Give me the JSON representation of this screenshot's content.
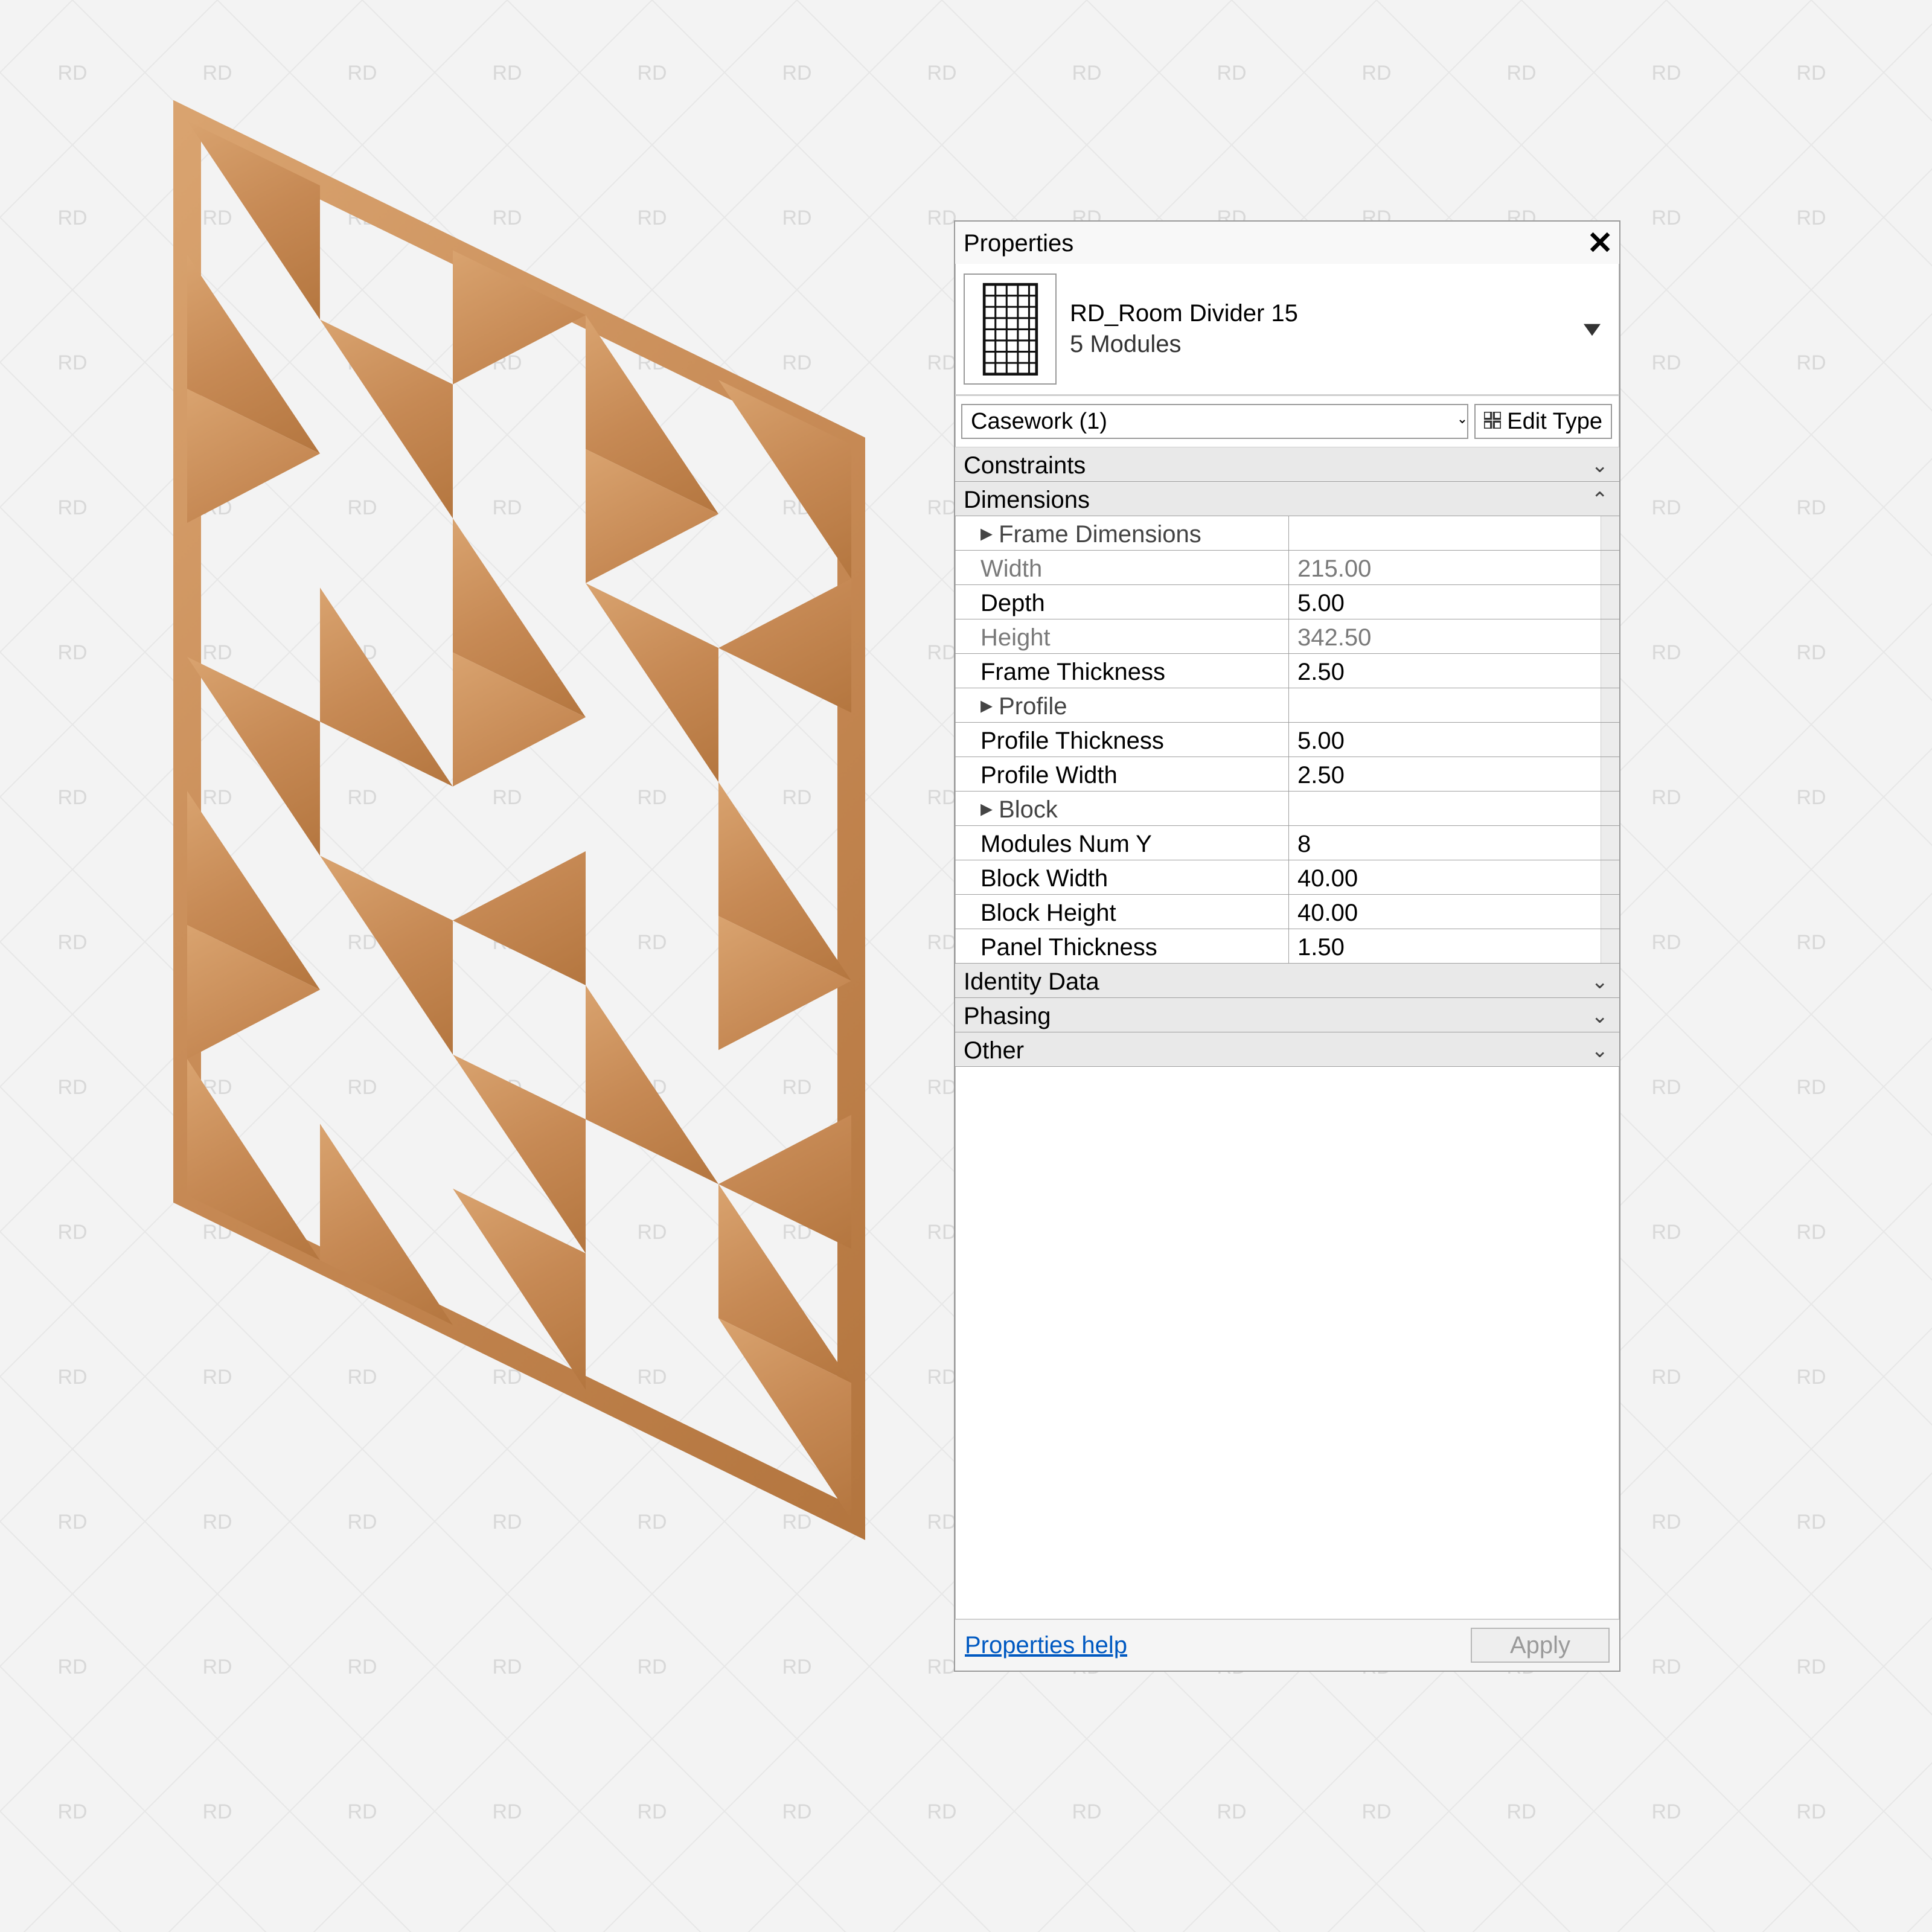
{
  "watermark_text": "RD",
  "properties": {
    "panel_title": "Properties",
    "family_name": "RD_Room Divider 15",
    "type_name": "5 Modules",
    "category_selector": "Casework (1)",
    "edit_type_label": "Edit Type",
    "groups": {
      "constraints_label": "Constraints",
      "dimensions_label": "Dimensions",
      "identity_label": "Identity Data",
      "phasing_label": "Phasing",
      "other_label": "Other"
    },
    "dimensions": {
      "frame_dimensions_label": "Frame Dimensions",
      "width_label": "Width",
      "width_value": "215.00",
      "depth_label": "Depth",
      "depth_value": "5.00",
      "height_label": "Height",
      "height_value": "342.50",
      "frame_thickness_label": "Frame Thickness",
      "frame_thickness_value": "2.50",
      "profile_label": "Profile",
      "profile_thickness_label": "Profile Thickness",
      "profile_thickness_value": "5.00",
      "profile_width_label": "Profile Width",
      "profile_width_value": "2.50",
      "block_label": "Block",
      "modules_num_y_label": "Modules Num Y",
      "modules_num_y_value": "8",
      "block_width_label": "Block Width",
      "block_width_value": "40.00",
      "block_height_label": "Block Height",
      "block_height_value": "40.00",
      "panel_thickness_label": "Panel Thickness",
      "panel_thickness_value": "1.50"
    },
    "help_label": "Properties help",
    "apply_label": "Apply"
  }
}
